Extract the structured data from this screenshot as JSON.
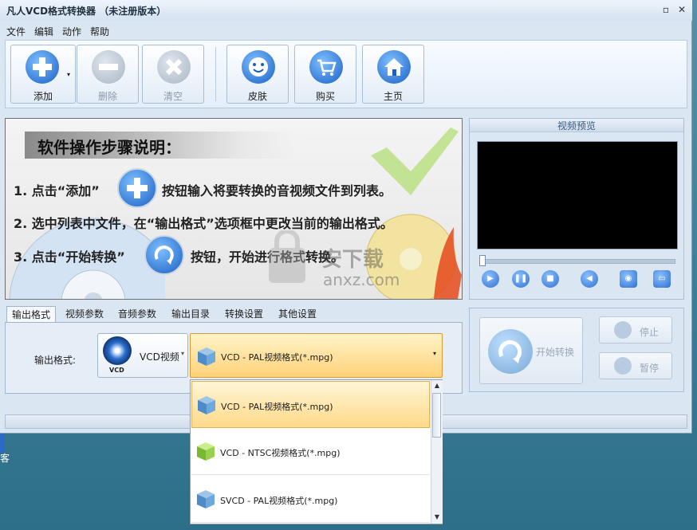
{
  "window": {
    "title": "凡人VCD格式转换器 （未注册版本）",
    "minimize": "▫",
    "close": "✕"
  },
  "menu": [
    "文件",
    "编辑",
    "动作",
    "帮助"
  ],
  "toolbar": {
    "add": "添加",
    "delete": "删除",
    "clear": "清空",
    "skin": "皮肤",
    "buy": "购买",
    "home": "主页"
  },
  "instructions": {
    "title": "软件操作步骤说明：",
    "step1_a": "1. 点击“添加”",
    "step1_b": "按钮输入将要转换的音视频文件到列表。",
    "step2": "2. 选中列表中文件，在“输出格式”选项框中更改当前的输出格式。",
    "step3_a": "3. 点击“开始转换”",
    "step3_b": "按钮，开始进行格式转换。"
  },
  "preview": {
    "title": "视频预览"
  },
  "tabs": [
    "输出格式",
    "视频参数",
    "音频参数",
    "输出目录",
    "转换设置",
    "其他设置"
  ],
  "output": {
    "label": "输出格式:",
    "category": "VCD视频",
    "category_icon_text": "VCD",
    "selected_format": "VCD - PAL视频格式(*.mpg)"
  },
  "controls": {
    "start": "开始转换",
    "stop": "停止",
    "pause": "暂停"
  },
  "dropdown": {
    "items": [
      "VCD - PAL视频格式(*.mpg)",
      "VCD - NTSC视频格式(*.mpg)",
      "SVCD - PAL视频格式(*.mpg)"
    ],
    "selected_index": 0
  },
  "watermark": {
    "line1": "安下载",
    "line2": "anxz.com"
  },
  "desktop_text": "客",
  "colors": {
    "accent": "#2f6fd0",
    "selection": "#ffd98a"
  }
}
